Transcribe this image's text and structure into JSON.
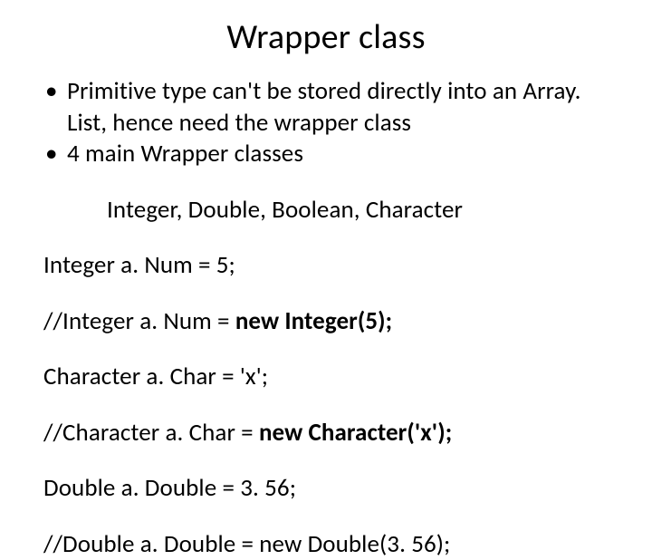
{
  "title": "Wrapper class",
  "lines": {
    "b1": "Primitive type can't be stored directly into an Array. List, hence need the wrapper class",
    "b2": "4 main Wrapper classes",
    "l3": "Integer, Double, Boolean, Character",
    "l4": "Integer a. Num = 5;",
    "l5_pre": "//Integer a. Num = ",
    "l5_bold": "new Integer(5);",
    "l6": "Character a. Char = 'x';",
    "l7_pre": "//Character a. Char = ",
    "l7_bold": "new Character('x');",
    "l8": "Double a. Double = 3. 56;",
    "l9": "//Double a. Double = new Double(3. 56);"
  }
}
